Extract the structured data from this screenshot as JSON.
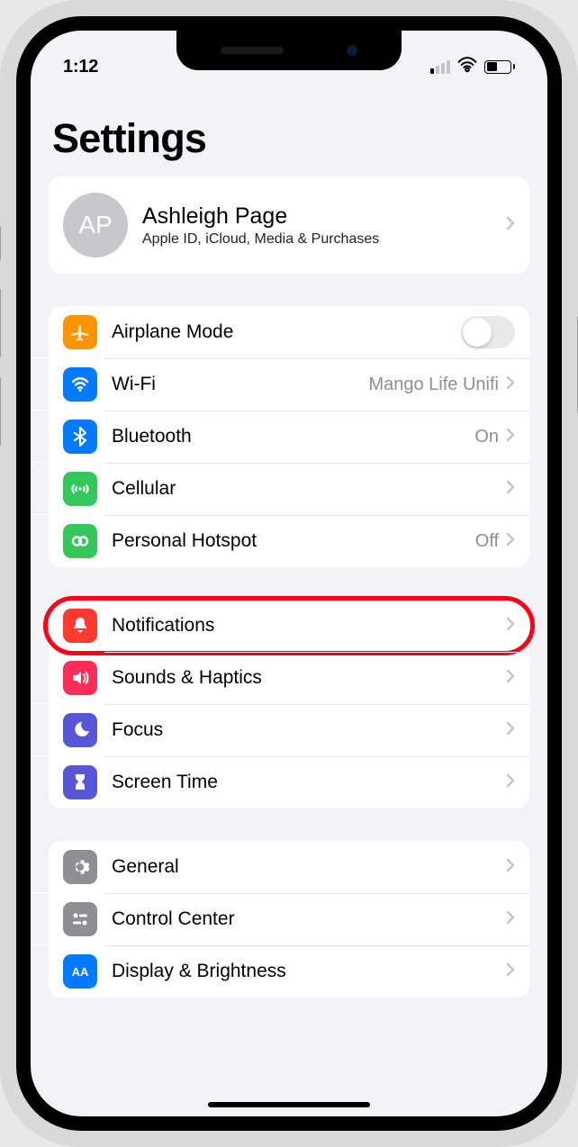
{
  "statusbar": {
    "time": "1:12"
  },
  "page": {
    "title": "Settings"
  },
  "profile": {
    "initials": "AP",
    "name": "Ashleigh Page",
    "subtitle": "Apple ID, iCloud, Media & Purchases"
  },
  "group1": {
    "airplane": {
      "label": "Airplane Mode"
    },
    "wifi": {
      "label": "Wi-Fi",
      "value": "Mango Life Unifi"
    },
    "bluetooth": {
      "label": "Bluetooth",
      "value": "On"
    },
    "cellular": {
      "label": "Cellular"
    },
    "hotspot": {
      "label": "Personal Hotspot",
      "value": "Off"
    }
  },
  "group2": {
    "notifications": {
      "label": "Notifications"
    },
    "sounds": {
      "label": "Sounds & Haptics"
    },
    "focus": {
      "label": "Focus"
    },
    "screentime": {
      "label": "Screen Time"
    }
  },
  "group3": {
    "general": {
      "label": "General"
    },
    "controlcenter": {
      "label": "Control Center"
    },
    "display": {
      "label": "Display & Brightness"
    }
  },
  "highlight_target": "notifications"
}
